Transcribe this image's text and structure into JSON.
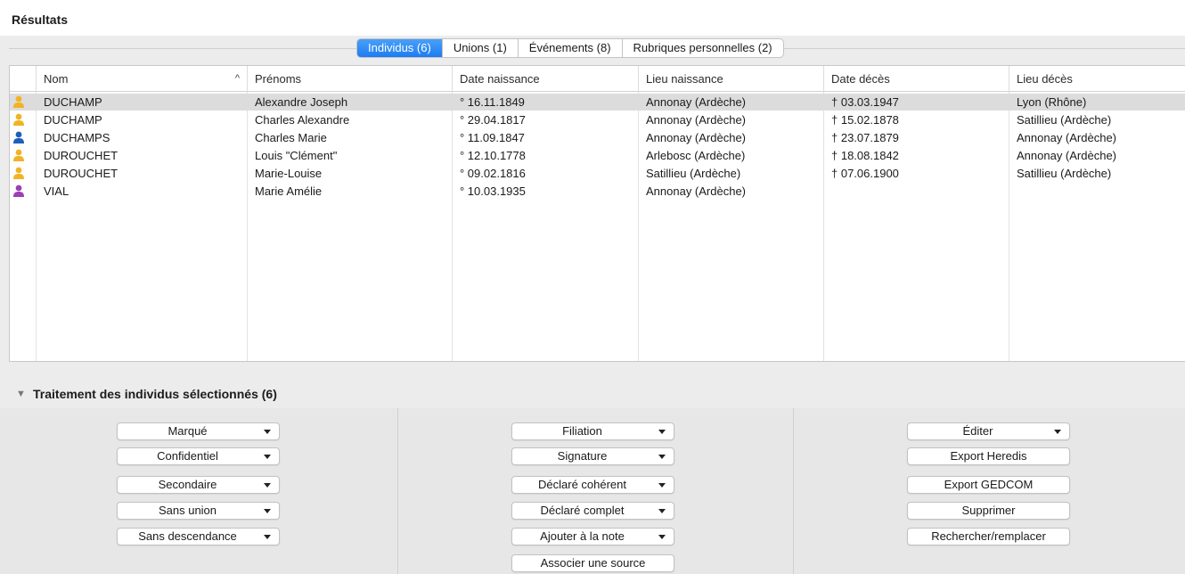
{
  "header": {
    "title": "Résultats"
  },
  "tabs": [
    {
      "label": "Individus (6)",
      "active": true
    },
    {
      "label": "Unions (1)",
      "active": false
    },
    {
      "label": "Événements (8)",
      "active": false
    },
    {
      "label": "Rubriques personnelles (2)",
      "active": false
    }
  ],
  "table": {
    "columns": [
      "Nom",
      "Prénoms",
      "Date naissance",
      "Lieu naissance",
      "Date décès",
      "Lieu décès"
    ],
    "sort_indicator": "^",
    "rows": [
      {
        "gender": "male",
        "nom": "DUCHAMP",
        "prenoms": "Alexandre Joseph",
        "date_naissance": "° 16.11.1849",
        "lieu_naissance": "Annonay (Ardèche)",
        "date_deces": "† 03.03.1947",
        "lieu_deces": "Lyon (Rhône)",
        "selected": true
      },
      {
        "gender": "male",
        "nom": "DUCHAMP",
        "prenoms": "Charles Alexandre",
        "date_naissance": "° 29.04.1817",
        "lieu_naissance": "Annonay (Ardèche)",
        "date_deces": "† 15.02.1878",
        "lieu_deces": "Satillieu (Ardèche)",
        "selected": false
      },
      {
        "gender": "male-blue",
        "nom": "DUCHAMPS",
        "prenoms": "Charles Marie",
        "date_naissance": "° 11.09.1847",
        "lieu_naissance": "Annonay (Ardèche)",
        "date_deces": "† 23.07.1879",
        "lieu_deces": "Annonay (Ardèche)",
        "selected": false
      },
      {
        "gender": "male",
        "nom": "DUROUCHET",
        "prenoms": "Louis \"Clément\"",
        "date_naissance": "° 12.10.1778",
        "lieu_naissance": "Arlebosc (Ardèche)",
        "date_deces": "† 18.08.1842",
        "lieu_deces": "Annonay (Ardèche)",
        "selected": false
      },
      {
        "gender": "female",
        "nom": "DUROUCHET",
        "prenoms": "Marie-Louise",
        "date_naissance": "° 09.02.1816",
        "lieu_naissance": "Satillieu (Ardèche)",
        "date_deces": "† 07.06.1900",
        "lieu_deces": "Satillieu (Ardèche)",
        "selected": false
      },
      {
        "gender": "female-purple",
        "nom": "VIAL",
        "prenoms": "Marie Amélie",
        "date_naissance": "° 10.03.1935",
        "lieu_naissance": "Annonay (Ardèche)",
        "date_deces": "",
        "lieu_deces": "",
        "selected": false
      }
    ]
  },
  "panel": {
    "title": "Traitement des individus sélectionnés (6)",
    "col1": [
      "Marqué",
      "Confidentiel",
      "Secondaire",
      "Sans union",
      "Sans descendance"
    ],
    "col2": [
      "Filiation",
      "Signature",
      "Déclaré cohérent",
      "Déclaré complet",
      "Ajouter à la note"
    ],
    "col2_plain": [
      "Associer une source"
    ],
    "col3_dropdown": [
      "Éditer"
    ],
    "col3_plain": [
      "Export Heredis",
      "Export GEDCOM",
      "Supprimer",
      "Rechercher/remplacer"
    ]
  },
  "colors": {
    "tab_active": "#1d7cf2",
    "person_male": "#f1b324",
    "person_male_blue": "#1f5fb8",
    "person_female": "#f1b324",
    "person_female_purple": "#9b3fb4",
    "row_selected": "#dcdcdc"
  },
  "icons": {
    "person": "person-icon",
    "sort": "sort-ascending-icon",
    "disclosure": "disclosure-triangle-icon",
    "caret": "chevron-down-icon"
  }
}
